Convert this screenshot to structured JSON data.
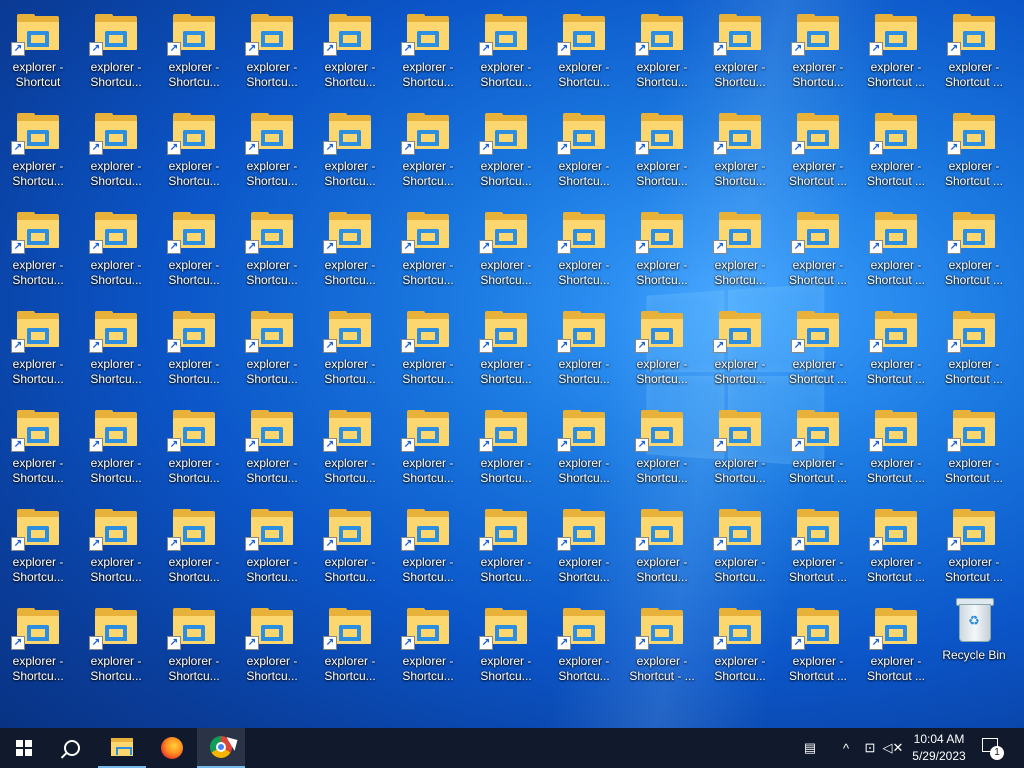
{
  "desktop": {
    "rows": [
      [
        "explorer - Shortcut",
        "explorer - Shortcu...",
        "explorer - Shortcu...",
        "explorer - Shortcu...",
        "explorer - Shortcu...",
        "explorer - Shortcu...",
        "explorer - Shortcu...",
        "explorer - Shortcu...",
        "explorer - Shortcu...",
        "explorer - Shortcu...",
        "explorer - Shortcu...",
        "explorer - Shortcut ...",
        "explorer - Shortcut ..."
      ],
      [
        "explorer - Shortcu...",
        "explorer - Shortcu...",
        "explorer - Shortcu...",
        "explorer - Shortcu...",
        "explorer - Shortcu...",
        "explorer - Shortcu...",
        "explorer - Shortcu...",
        "explorer - Shortcu...",
        "explorer - Shortcu...",
        "explorer - Shortcu...",
        "explorer - Shortcut ...",
        "explorer - Shortcut ...",
        "explorer - Shortcut ..."
      ],
      [
        "explorer - Shortcu...",
        "explorer - Shortcu...",
        "explorer - Shortcu...",
        "explorer - Shortcu...",
        "explorer - Shortcu...",
        "explorer - Shortcu...",
        "explorer - Shortcu...",
        "explorer - Shortcu...",
        "explorer - Shortcu...",
        "explorer - Shortcu...",
        "explorer - Shortcut ...",
        "explorer - Shortcut ...",
        "explorer - Shortcut ..."
      ],
      [
        "explorer - Shortcu...",
        "explorer - Shortcu...",
        "explorer - Shortcu...",
        "explorer - Shortcu...",
        "explorer - Shortcu...",
        "explorer - Shortcu...",
        "explorer - Shortcu...",
        "explorer - Shortcu...",
        "explorer - Shortcu...",
        "explorer - Shortcu...",
        "explorer - Shortcut ...",
        "explorer - Shortcut ...",
        "explorer - Shortcut ..."
      ],
      [
        "explorer - Shortcu...",
        "explorer - Shortcu...",
        "explorer - Shortcu...",
        "explorer - Shortcu...",
        "explorer - Shortcu...",
        "explorer - Shortcu...",
        "explorer - Shortcu...",
        "explorer - Shortcu...",
        "explorer - Shortcu...",
        "explorer - Shortcu...",
        "explorer - Shortcut ...",
        "explorer - Shortcut ...",
        "explorer - Shortcut ..."
      ],
      [
        "explorer - Shortcu...",
        "explorer - Shortcu...",
        "explorer - Shortcu...",
        "explorer - Shortcu...",
        "explorer - Shortcu...",
        "explorer - Shortcu...",
        "explorer - Shortcu...",
        "explorer - Shortcu...",
        "explorer - Shortcu...",
        "explorer - Shortcu...",
        "explorer - Shortcut ...",
        "explorer - Shortcut ...",
        "explorer - Shortcut ..."
      ],
      [
        "explorer - Shortcu...",
        "explorer - Shortcu...",
        "explorer - Shortcu...",
        "explorer - Shortcu...",
        "explorer - Shortcu...",
        "explorer - Shortcu...",
        "explorer - Shortcu...",
        "explorer - Shortcu...",
        "explorer - Shortcut - ...",
        "explorer - Shortcu...",
        "explorer - Shortcut ...",
        "explorer - Shortcut ..."
      ]
    ],
    "recycle_bin": {
      "label": "Recycle Bin",
      "icon": "recycle-bin-icon"
    },
    "shortcut_icon": "folder-shortcut-icon"
  },
  "taskbar": {
    "start_icon": "windows-logo-icon",
    "search_icon": "search-icon",
    "apps": [
      {
        "name": "File Explorer",
        "icon": "file-explorer-icon",
        "state": "running"
      },
      {
        "name": "Firefox",
        "icon": "firefox-icon",
        "state": "pinned"
      },
      {
        "name": "Google Chrome",
        "icon": "chrome-icon",
        "state": "active"
      }
    ],
    "tray": {
      "keyboard_icon": "touch-keyboard-icon",
      "chevron_icon": "chevron-up-icon",
      "network_icon": "network-icon",
      "volume_icon": "volume-muted-icon",
      "time": "10:04 AM",
      "date": "5/29/2023",
      "notification_count": "1"
    }
  },
  "colors": {
    "accent": "#76b9ed",
    "taskbar_bg": "#101a2c",
    "folder_yellow": "#fcd770"
  }
}
